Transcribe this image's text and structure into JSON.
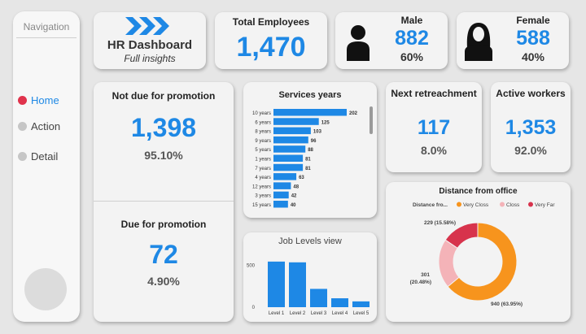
{
  "nav": {
    "title": "Navigation",
    "items": [
      {
        "label": "Home",
        "active": true
      },
      {
        "label": "Action",
        "active": false
      },
      {
        "label": "Detail",
        "active": false
      }
    ]
  },
  "header": {
    "title": "HR Dashboard",
    "subtitle": "Full insights"
  },
  "total": {
    "title": "Total Employees",
    "value": "1,470"
  },
  "male": {
    "title": "Male",
    "value": "882",
    "pct": "60%"
  },
  "female": {
    "title": "Female",
    "value": "588",
    "pct": "40%"
  },
  "not_due": {
    "title": "Not due for promotion",
    "value": "1,398",
    "pct": "95.10%"
  },
  "due": {
    "title": "Due for promotion",
    "value": "72",
    "pct": "4.90%"
  },
  "retrench": {
    "title": "Next retreachment",
    "value": "117",
    "pct": "8.0%"
  },
  "active": {
    "title": "Active workers",
    "value": "1,353",
    "pct": "92.0%"
  },
  "colors": {
    "accent": "#1e88e5",
    "orange": "#f7941d",
    "pink": "#f4b3b8",
    "red": "#d7334c"
  },
  "chart_data": [
    {
      "type": "bar",
      "orientation": "horizontal",
      "title": "Services years",
      "categories": [
        "10 years",
        "6 years",
        "8 years",
        "9 years",
        "5 years",
        "1 years",
        "7 years",
        "4 years",
        "12 years",
        "3 years",
        "15 years"
      ],
      "values": [
        202,
        125,
        103,
        96,
        88,
        81,
        81,
        63,
        48,
        42,
        40
      ]
    },
    {
      "type": "bar",
      "title": "Job Levels view",
      "categories": [
        "Level 1",
        "Level 2",
        "Level 3",
        "Level 4",
        "Level 5"
      ],
      "values": [
        543,
        534,
        218,
        106,
        69
      ],
      "yticks": [
        0,
        500
      ],
      "ylim": [
        0,
        600
      ]
    },
    {
      "type": "pie",
      "title": "Distance from office",
      "legend_title": "Distance fro...",
      "legend_position": "top",
      "slices": [
        {
          "name": "Very Closs",
          "value": 940,
          "label": "940 (63.95%)",
          "color": "#f7941d"
        },
        {
          "name": "Closs",
          "value": 301,
          "label": "301 (20.48%)",
          "color": "#f4b3b8"
        },
        {
          "name": "Very Far",
          "value": 229,
          "label": "229 (15.58%)",
          "color": "#d7334c"
        }
      ]
    }
  ]
}
